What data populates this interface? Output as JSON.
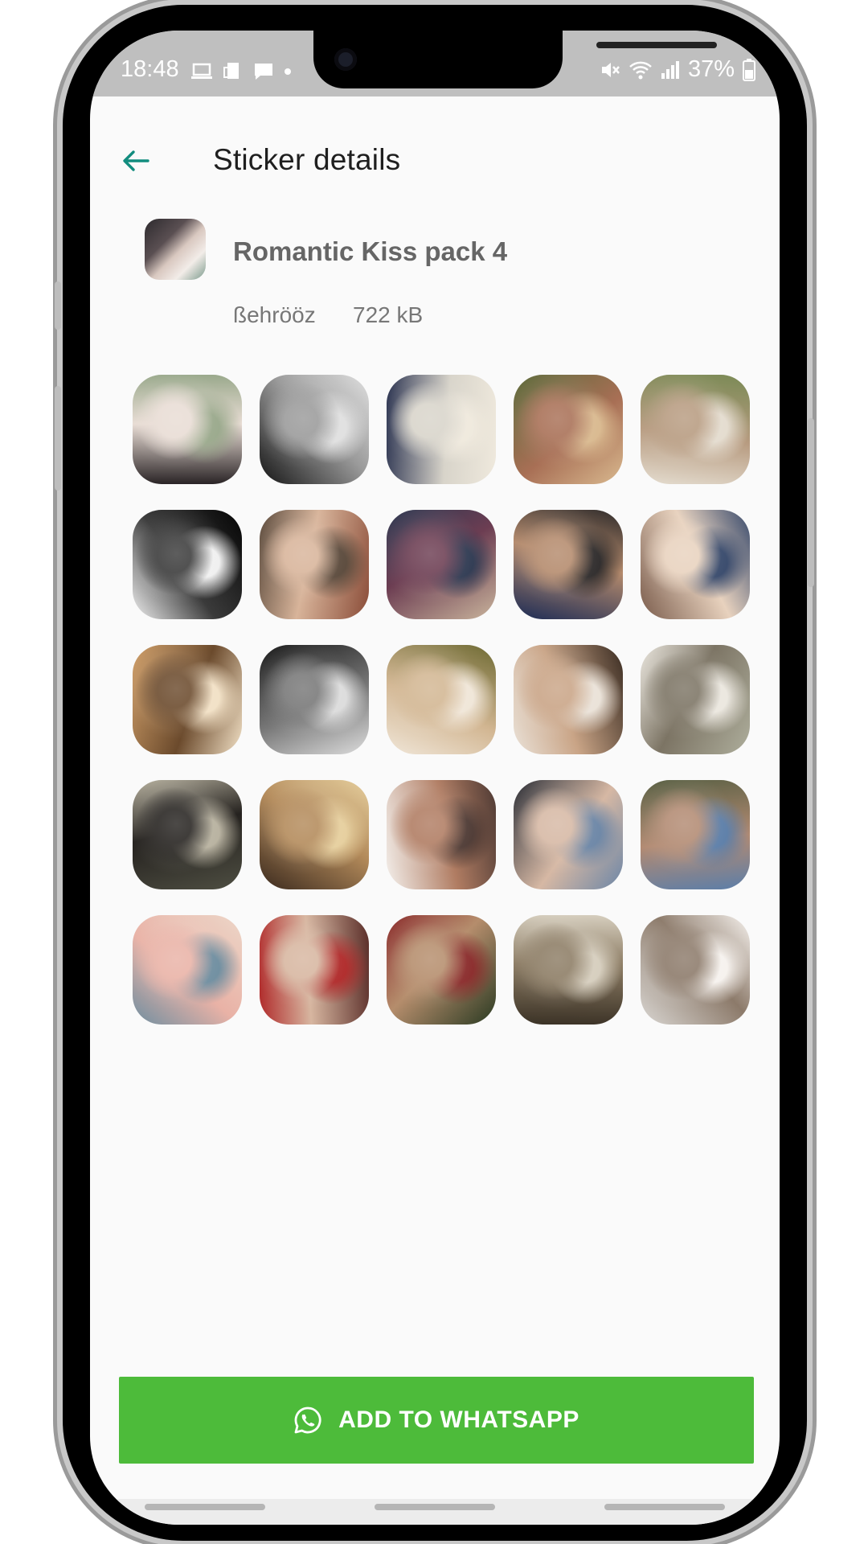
{
  "status_bar": {
    "time": "18:48",
    "battery": "37%",
    "left_icons": [
      "laptop-icon",
      "cast-icon",
      "chat-icon",
      "dot-icon"
    ],
    "right_icons": [
      "mute-icon",
      "wifi-icon",
      "signal-icon",
      "battery-icon"
    ]
  },
  "header": {
    "title": "Sticker details",
    "back_icon": "back-arrow-icon"
  },
  "pack": {
    "name": "Romantic Kiss pack 4",
    "publisher": "ßehrööz",
    "size": "722 kB"
  },
  "stickers": [
    {
      "colors": [
        "#2a2426",
        "#e8dcd4",
        "#9aa98c"
      ]
    },
    {
      "colors": [
        "#151515",
        "#9a9a9a",
        "#e0e0e0"
      ]
    },
    {
      "colors": [
        "#2b3350",
        "#d8d4ca",
        "#efe9dd"
      ]
    },
    {
      "colors": [
        "#5c6a3a",
        "#a86f55",
        "#d9b98f"
      ]
    },
    {
      "colors": [
        "#7a8a55",
        "#b79b80",
        "#e4dccf"
      ]
    },
    {
      "colors": [
        "#050505",
        "#3a3a3a",
        "#f0f0f0"
      ]
    },
    {
      "colors": [
        "#8a4c38",
        "#d8b49a",
        "#5b4a3c"
      ]
    },
    {
      "colors": [
        "#c9b49c",
        "#6c3d52",
        "#2f3a52"
      ]
    },
    {
      "colors": [
        "#1c2b55",
        "#b48a6c",
        "#2e2b2b"
      ]
    },
    {
      "colors": [
        "#7a5c4c",
        "#e8d2be",
        "#384a6c"
      ]
    },
    {
      "colors": [
        "#d1a06a",
        "#6b4a2c",
        "#f2e1c6"
      ]
    },
    {
      "colors": [
        "#1a1a1a",
        "#777777",
        "#dcdcdc"
      ]
    },
    {
      "colors": [
        "#6e6a33",
        "#d2b692",
        "#f0e6d8"
      ]
    },
    {
      "colors": [
        "#3a2c22",
        "#c9a486",
        "#eae2d8"
      ]
    },
    {
      "colors": [
        "#aeae9c",
        "#7c7464",
        "#ebe7df"
      ]
    },
    {
      "colors": [
        "#4e4e42",
        "#25221f",
        "#b8b2a0"
      ]
    },
    {
      "colors": [
        "#3b2a1e",
        "#b38a5a",
        "#e6cf9e"
      ]
    },
    {
      "colors": [
        "#f4f0ec",
        "#b07c62",
        "#4e3a34"
      ]
    },
    {
      "colors": [
        "#2a2d35",
        "#d6b8a4",
        "#6c86a6"
      ]
    },
    {
      "colors": [
        "#5a6044",
        "#b28a72",
        "#5c7ea8"
      ]
    },
    {
      "colors": [
        "#ecd6c8",
        "#e9b2a6",
        "#6f8ea0"
      ]
    },
    {
      "colors": [
        "#5b2f2a",
        "#d7b6a0",
        "#b02a2a"
      ]
    },
    {
      "colors": [
        "#2a3a22",
        "#b58d6c",
        "#8a2b2b"
      ]
    },
    {
      "colors": [
        "#3b3226",
        "#8c7c64",
        "#d6cebe"
      ]
    },
    {
      "colors": [
        "#d9d6d2",
        "#8c7a6a",
        "#f6f2ee"
      ]
    }
  ],
  "add_button": {
    "label": "ADD TO WHATSAPP",
    "icon": "whatsapp-icon",
    "color": "#4dbb3a"
  },
  "colors": {
    "accent_teal": "#128c7e",
    "background": "#fafafa"
  }
}
